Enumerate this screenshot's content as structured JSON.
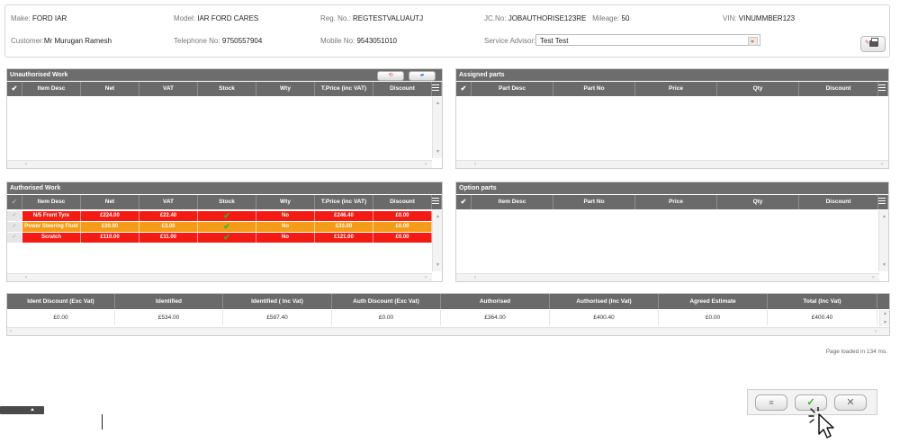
{
  "vehicle": {
    "make_label": "Make:",
    "make": "FORD IAR",
    "model_label": "Model:",
    "model": "IAR FORD CARES",
    "reg_label": "Reg. No.:",
    "reg": "REGTESTVALUAUTJ",
    "jc_label": "JC.No:",
    "jc": "JOBAUTHORISE123RE",
    "mileage_label": "Mileage:",
    "mileage": "50",
    "vin_label": "VIN:",
    "vin": "VINUMMBER123",
    "customer_label": "Customer:",
    "customer": "Mr Murugan Ramesh",
    "telephone_label": "Telephone No:",
    "telephone": "9750557904",
    "mobile_label": "Mobile No:",
    "mobile": "9543051010",
    "advisor_label": "Service Advisor:",
    "advisor": "Test Test"
  },
  "unauthorised": {
    "title": "Unauthorised Work",
    "columns": [
      "Item Desc",
      "Net",
      "VAT",
      "Stock",
      "Wty",
      "T.Price (inc VAT)",
      "Discount"
    ]
  },
  "assigned": {
    "title": "Assigned parts",
    "columns": [
      "Part Desc",
      "Part No",
      "Price",
      "Qty",
      "Discount"
    ]
  },
  "authorised": {
    "title": "Authorised Work",
    "columns": [
      "Item Desc",
      "Net",
      "VAT",
      "Stock",
      "Wty",
      "T.Price (inc VAT)",
      "Discount"
    ],
    "rows": [
      {
        "desc": "N/5 Front Tyre",
        "net": "£224.00",
        "vat": "£22.40",
        "wty": "No",
        "price": "£246.40",
        "discount": "£0.00",
        "color": "#f41b14"
      },
      {
        "desc": "Power Steering Fluid",
        "net": "£30.00",
        "vat": "£3.00",
        "wty": "No",
        "price": "£33.00",
        "discount": "£0.00",
        "color": "#f49c17"
      },
      {
        "desc": "Scratch",
        "net": "£110.00",
        "vat": "£11.00",
        "wty": "No",
        "price": "£121.00",
        "discount": "£0.00",
        "color": "#f41b14"
      }
    ]
  },
  "option": {
    "title": "Option parts",
    "columns": [
      "Item Desc",
      "Part No",
      "Price",
      "Qty",
      "Discount"
    ]
  },
  "summary": {
    "headers": [
      "Ident Discount (Exc Vat)",
      "Identified",
      "Identified ( Inc Vat)",
      "Auth Discount (Exc Vat)",
      "Authorised",
      "Authorised (Inc Vat)",
      "Agreed Estimate",
      "Total (Inc Vat)"
    ],
    "values": [
      "£0.00",
      "£534.00",
      "£587.40",
      "£0.00",
      "£364.00",
      "£400.40",
      "£0.00",
      "£400.40"
    ]
  },
  "status": {
    "loaded": "Page loaded in 134 ms."
  },
  "colors": {
    "header_gray": "#6a6a6a",
    "row_red": "#f41b14",
    "row_orange": "#f49c17",
    "tick_green": "#3dae2b"
  }
}
